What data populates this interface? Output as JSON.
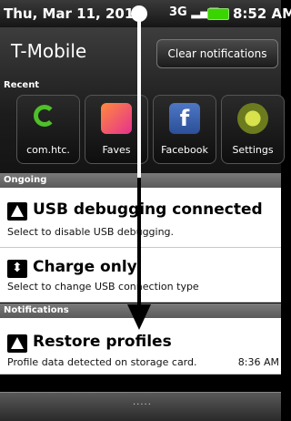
{
  "status": {
    "date": "Thu, Mar 11, 201",
    "time": "8:52 AM"
  },
  "shade": {
    "carrier": "T-Mobile",
    "clear_button": "Clear notifications",
    "recent_label": "Recent"
  },
  "recent_apps": [
    {
      "label": "com.htc.",
      "icon": "sync-icon"
    },
    {
      "label": "Faves",
      "icon": "faves-icon"
    },
    {
      "label": "Facebook",
      "icon": "facebook-icon"
    },
    {
      "label": "Settings",
      "icon": "settings-icon"
    }
  ],
  "sections": {
    "ongoing": "Ongoing",
    "notifications": "Notifications"
  },
  "ongoing": [
    {
      "title": "USB debugging connected",
      "subtitle": "Select to disable USB debugging.",
      "icon": "warning-icon"
    },
    {
      "title": "Charge only",
      "subtitle": "Select to change USB connection type",
      "icon": "usb-icon"
    }
  ],
  "notifications": [
    {
      "title": "Restore profiles",
      "subtitle": "Profile data detected on storage card.",
      "time": "8:36 AM",
      "icon": "warning-icon"
    }
  ],
  "handle": {
    "dots": "·····"
  }
}
